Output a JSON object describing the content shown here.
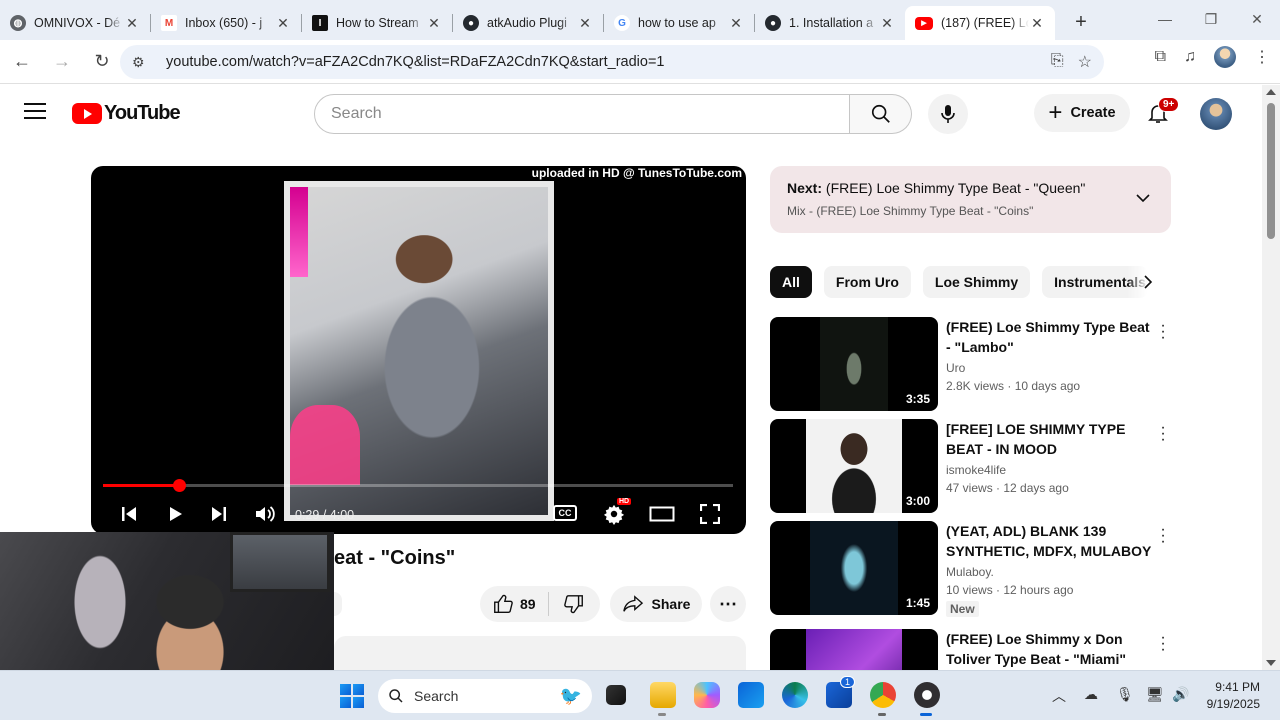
{
  "browser": {
    "tabs": [
      {
        "title": "OMNIVOX - Dé",
        "icon": "globe-icon",
        "color": "#5f6368"
      },
      {
        "title": "Inbox (650) - j",
        "icon": "gmail-icon",
        "color": "#ea4335"
      },
      {
        "title": "How to Stream",
        "icon": "site-icon",
        "color": "#111111"
      },
      {
        "title": "atkAudio Plugi",
        "icon": "github-icon",
        "color": "#24292f"
      },
      {
        "title": "how to use ap",
        "icon": "google-icon",
        "color": "#4285f4"
      },
      {
        "title": "1. Installation a",
        "icon": "github-icon",
        "color": "#24292f"
      },
      {
        "title": "(187) (FREE) Lo",
        "icon": "youtube-icon",
        "color": "#ff0000"
      }
    ],
    "url": "youtube.com/watch?v=aFZA2Cdn7KQ&list=RDaFZA2Cdn7KQ&start_radio=1"
  },
  "yt": {
    "logo_text": "YouTube",
    "search_placeholder": "Search",
    "create_label": "Create",
    "notif_badge": "9+"
  },
  "player": {
    "watermark": "uploaded in HD @ TunesToTube.com",
    "time_current": "0:29",
    "time_sep": " / ",
    "time_total": "4:00",
    "progress_fraction": 0.121,
    "cc_label": "CC",
    "hd_label": "HD"
  },
  "video": {
    "title_visible": "eat - \"Coins\"",
    "like_count": "89",
    "share_label": "Share"
  },
  "sidebar": {
    "next_label": "Next:",
    "next_title": "(FREE) Loe Shimmy Type Beat - \"Queen\"",
    "mix_title": "Mix - (FREE) Loe Shimmy Type Beat - \"Coins\"",
    "chips": [
      "All",
      "From Uro",
      "Loe Shimmy",
      "Instrumentals"
    ],
    "recs": [
      {
        "title": "(FREE) Loe Shimmy Type Beat - \"Lambo\"",
        "channel": "Uro",
        "views": "2.8K views",
        "age": "10 days ago",
        "duration": "3:35",
        "badge": ""
      },
      {
        "title": "[FREE] LOE SHIMMY TYPE BEAT - IN MOOD",
        "channel": "ismoke4life",
        "views": "47 views",
        "age": "12 days ago",
        "duration": "3:00",
        "badge": ""
      },
      {
        "title": "(YEAT, ADL) BLANK 139 SYNTHETIC, MDFX, MULABOY",
        "channel": "Mulaboy.",
        "views": "10 views",
        "age": "12 hours ago",
        "duration": "1:45",
        "badge": "New"
      },
      {
        "title": "(FREE) Loe Shimmy x Don Toliver Type Beat - \"Miami\"",
        "channel": "",
        "views": "",
        "age": "",
        "duration": "",
        "badge": ""
      }
    ]
  },
  "taskbar": {
    "search_label": "Search",
    "time": "9:41 PM",
    "date": "9/19/2025",
    "store_badge": "1"
  }
}
